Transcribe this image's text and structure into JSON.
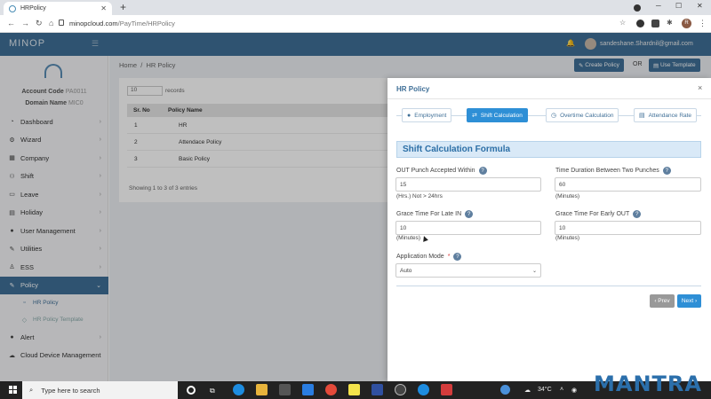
{
  "browser": {
    "tab_title": "HRPolicy",
    "url_domain": "minopcloud.com",
    "url_path": "/PayTime/HRPolicy",
    "profile_initial": "R"
  },
  "app": {
    "logo": "MINOP",
    "user_email": "sandeshane.Shardnil@gmail.com"
  },
  "sidebar": {
    "account_code_label": "Account Code",
    "account_code_value": "PA0011",
    "domain_name_label": "Domain Name",
    "domain_name_value": "MIC0",
    "items": [
      {
        "label": "Dashboard",
        "icon": "dashboard-icon"
      },
      {
        "label": "Wizard",
        "icon": "wizard-icon"
      },
      {
        "label": "Company",
        "icon": "company-icon"
      },
      {
        "label": "Shift",
        "icon": "shift-icon"
      },
      {
        "label": "Leave",
        "icon": "leave-icon"
      },
      {
        "label": "Holiday",
        "icon": "holiday-icon"
      },
      {
        "label": "User Management",
        "icon": "user-icon"
      },
      {
        "label": "Utilities",
        "icon": "utilities-icon"
      },
      {
        "label": "ESS",
        "icon": "ess-icon"
      },
      {
        "label": "Policy",
        "icon": "policy-icon"
      }
    ],
    "sub_items": [
      "HR Policy",
      "HR Policy Template"
    ],
    "bottom_items": [
      {
        "label": "Alert",
        "icon": "alert-icon"
      },
      {
        "label": "Cloud Device Management",
        "icon": "cloud-icon"
      }
    ]
  },
  "page": {
    "breadcrumb_home": "Home",
    "breadcrumb_sep": "/",
    "breadcrumb_current": "HR Policy",
    "create_button": "Create Policy",
    "or_label": "OR",
    "use_template_button": "Use Template",
    "show_value": "10",
    "records_label": "records",
    "table_headers": [
      "Sr. No",
      "Policy Name"
    ],
    "rows": [
      {
        "sr": "1",
        "name": "HR"
      },
      {
        "sr": "2",
        "name": "Attendace Policy"
      },
      {
        "sr": "3",
        "name": "Basic Policy"
      }
    ],
    "entries_text": "Showing 1 to 3 of 3 entries"
  },
  "modal": {
    "title": "HR Policy",
    "close": "×",
    "steps": [
      {
        "label": "Employment",
        "icon": "person-icon"
      },
      {
        "label": "Shift Calculation",
        "icon": "exchange-icon"
      },
      {
        "label": "Overtime Calculation",
        "icon": "clock-icon"
      },
      {
        "label": "Attendance Rate",
        "icon": "document-icon"
      }
    ],
    "section_title": "Shift Calculation Formula",
    "fields": {
      "out_punch_label": "OUT Punch Accepted Within",
      "out_punch_value": "15",
      "out_punch_hint": "(Hrs.) Not > 24hrs",
      "time_duration_label": "Time Duration Between Two Punches",
      "time_duration_value": "60",
      "time_duration_hint": "(Minutes)",
      "grace_late_label": "Grace Time For Late IN",
      "grace_late_value": "10",
      "grace_late_hint": "(Minutes)",
      "grace_early_label": "Grace Time For Early OUT",
      "grace_early_value": "10",
      "grace_early_hint": "(Minutes)",
      "app_mode_label": "Application Mode",
      "app_mode_required": "*",
      "app_mode_value": "Auto"
    },
    "prev_button": "‹ Prev",
    "next_button": "Next ›"
  },
  "taskbar": {
    "search_placeholder": "Type here to search",
    "temperature": "34°C",
    "watermark": "MANTRA"
  }
}
